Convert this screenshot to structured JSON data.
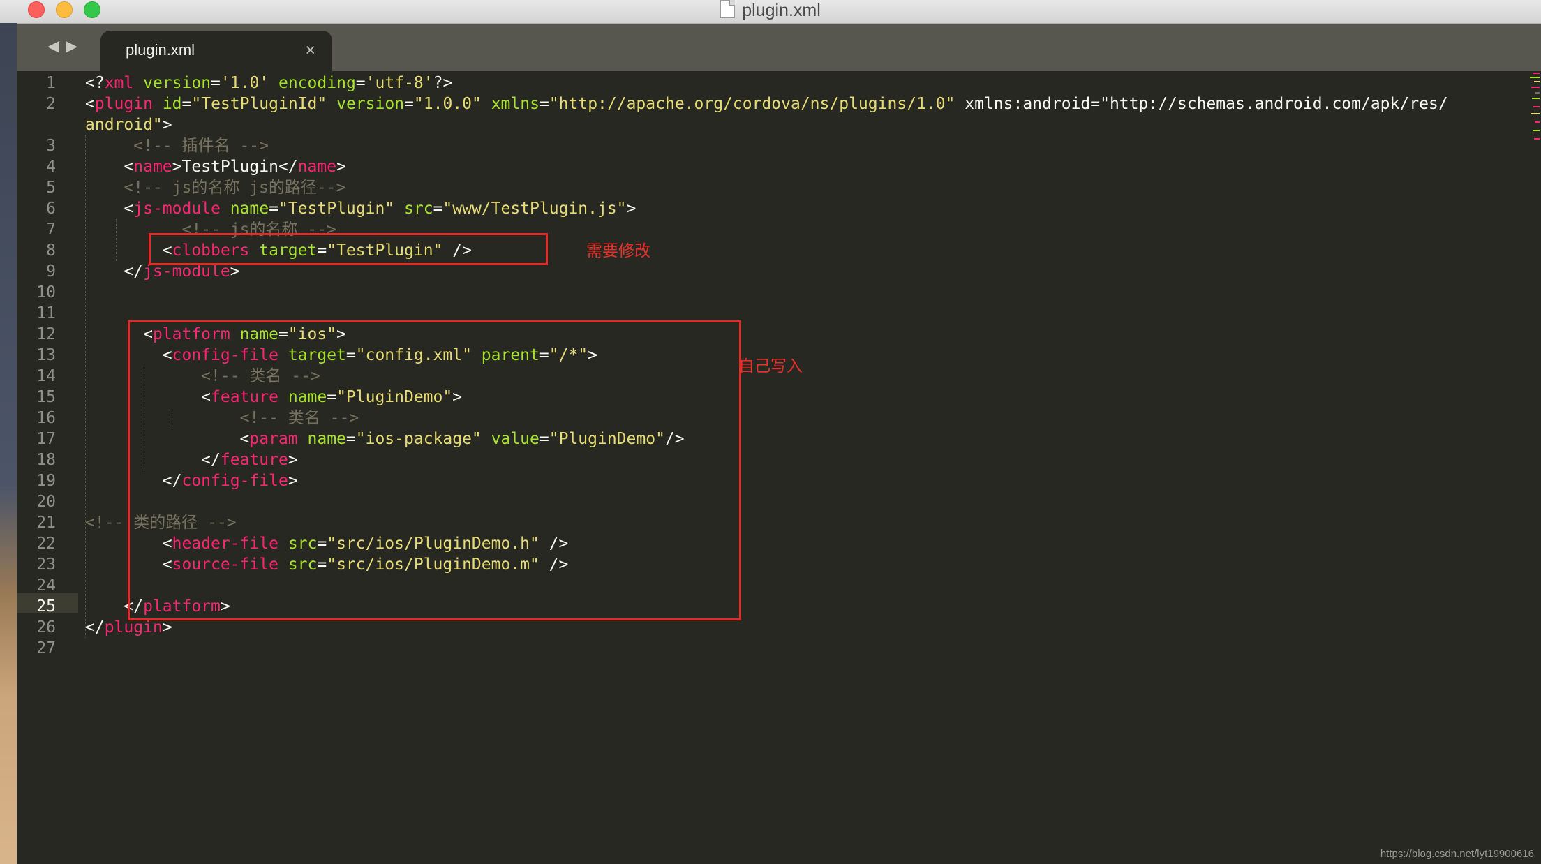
{
  "window": {
    "title": "plugin.xml"
  },
  "tabbar": {
    "back_glyph": "◀",
    "forward_glyph": "▶",
    "tab_label": "plugin.xml",
    "tab_close_glyph": "×"
  },
  "editor": {
    "current_line": 25,
    "line_numbers": [
      "1",
      "2",
      "3",
      "4",
      "5",
      "6",
      "7",
      "8",
      "9",
      "10",
      "11",
      "12",
      "13",
      "14",
      "15",
      "16",
      "17",
      "18",
      "19",
      "20",
      "21",
      "22",
      "23",
      "24",
      "25",
      "26",
      "27"
    ],
    "code_lines": [
      "<?xml version='1.0' encoding='utf-8'?>",
      "<plugin id=\"TestPluginId\" version=\"1.0.0\" xmlns=\"http://apache.org/cordova/ns/plugins/1.0\" xmlns:android=\"http://schemas.android.com/apk/res/",
      "android\">",
      "     <!-- 插件名 -->",
      "    <name>TestPlugin</name>",
      "    <!-- js的名称 js的路径-->",
      "    <js-module name=\"TestPlugin\" src=\"www/TestPlugin.js\">",
      "          <!-- js的名称 -->",
      "        <clobbers target=\"TestPlugin\" />",
      "    </js-module>",
      "",
      "",
      "      <platform name=\"ios\">",
      "        <config-file target=\"config.xml\" parent=\"/*\">",
      "            <!-- 类名 -->",
      "            <feature name=\"PluginDemo\">",
      "                <!-- 类名 -->",
      "                <param name=\"ios-package\" value=\"PluginDemo\"/>",
      "            </feature>",
      "        </config-file>",
      "",
      "<!-- 类的路径 -->",
      "        <header-file src=\"src/ios/PluginDemo.h\" />",
      "        <source-file src=\"src/ios/PluginDemo.m\" />",
      "",
      "    </platform>",
      "</plugin>",
      ""
    ]
  },
  "annotations": {
    "clobbers_note": "需要修改",
    "platform_note": "自己写入"
  },
  "watermark": "https://blog.csdn.net/lyt19900616",
  "colors": {
    "tag": "#f92672",
    "attribute": "#a6e22e",
    "string": "#e6db74",
    "comment": "#75715e",
    "text": "#f8f8f2",
    "highlight_box": "#e12b27"
  }
}
